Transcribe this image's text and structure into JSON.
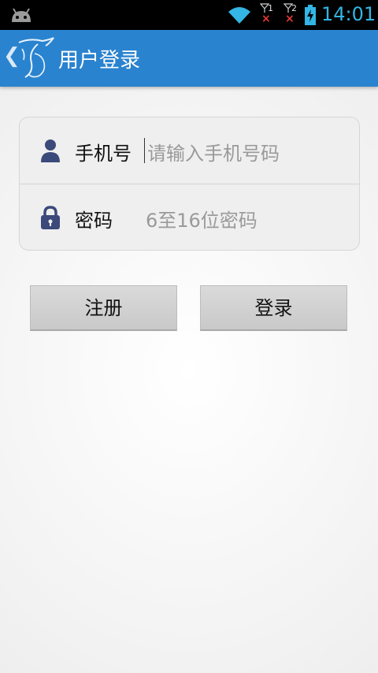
{
  "status_bar": {
    "time": "14:01",
    "sim1_label": "1",
    "sim2_label": "2",
    "sim_status_symbol": "×",
    "icons": [
      "android-icon",
      "wifi-icon",
      "signal-sim1-icon",
      "signal-sim2-icon",
      "battery-charging-icon"
    ],
    "accent_color": "#33b5e5"
  },
  "app_bar": {
    "back_symbol": "❮",
    "title": "用户登录",
    "background_color": "#2a83cf"
  },
  "form": {
    "phone": {
      "label": "手机号",
      "placeholder": "请输入手机号码"
    },
    "password": {
      "label": "密码",
      "placeholder": "6至16位密码"
    }
  },
  "buttons": {
    "register_label": "注册",
    "login_label": "登录"
  }
}
